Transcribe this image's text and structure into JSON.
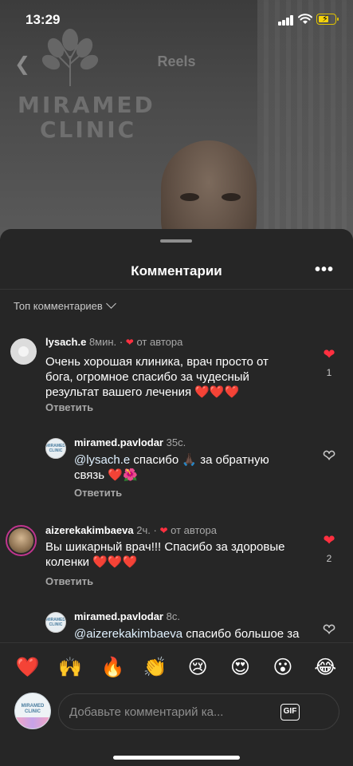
{
  "status_bar": {
    "time": "13:29"
  },
  "reels_header": {
    "title": "Reels"
  },
  "background": {
    "logo_line1": "MIRAMED",
    "logo_line2": "CLINIC"
  },
  "sheet": {
    "title": "Комментарии",
    "sort_label": "Топ комментариев"
  },
  "comments": [
    {
      "user": "lysach.e",
      "ago": "8мин.",
      "author_label": "от автора",
      "text": "Очень хорошая клиника, врач просто от бога, огромное спасибо за чудесный результат вашего лечения ❤️❤️❤️",
      "reply": "Ответить",
      "likes": "1"
    },
    {
      "user": "miramed.pavlodar",
      "ago": "35с.",
      "mention": "@lysach.e",
      "text": " спасибо 🙏🏿 за обратную связь ❤️🌺",
      "reply": "Ответить"
    },
    {
      "user": "aizerekakimbaeva",
      "ago": "2ч.",
      "author_label": "от автора",
      "text": "Вы шикарный врач!!! Спасибо за здоровые коленки ❤️❤️❤️",
      "reply": "Ответить",
      "likes": "2"
    },
    {
      "user": "miramed.pavlodar",
      "ago": "8с.",
      "mention": "@aizerekakimbaeva",
      "text": " спасибо большое за"
    }
  ],
  "avatar_labels": {
    "clinic": "MIRAMED CLINIC"
  },
  "quick_emojis": [
    "❤️",
    "🙌",
    "🔥",
    "👏",
    "😢",
    "😍",
    "😮",
    "😂"
  ],
  "composer": {
    "placeholder": "Добавьте комментарий ка...",
    "gif_label": "GIF"
  },
  "colors": {
    "sheet_bg": "#262626",
    "like_red": "#ff3040",
    "story_ring": "#c1358e"
  }
}
